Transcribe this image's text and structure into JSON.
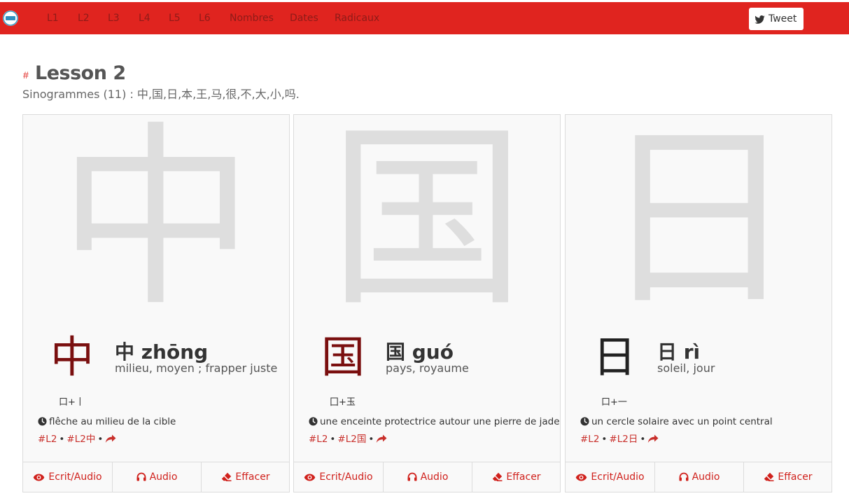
{
  "nav": {
    "items": [
      "L1",
      "L2",
      "L3",
      "L4",
      "L5",
      "L6",
      "Nombres",
      "Dates",
      "Radicaux"
    ],
    "tweet_label": "Tweet"
  },
  "lesson": {
    "hash": "#",
    "title": "Lesson 2",
    "subtitle": "Sinogrammes (11) : 中,国,日,本,王,马,很,不,大,小,吗."
  },
  "cards": [
    {
      "character": "中",
      "headword": "中 zhōng",
      "meaning": "milieu, moyen ; frapper juste",
      "decomposition": "口+丨",
      "mnemonic": "flêche au milieu de la cible",
      "tags": [
        "#L2",
        "#L2中"
      ],
      "actions": [
        "Ecrit/Audio",
        "Audio",
        "Effacer"
      ]
    },
    {
      "character": "国",
      "headword": "国 guó",
      "meaning": "pays, royaume",
      "decomposition": "囗+玉",
      "mnemonic": "une enceinte protectrice autour une pierre de jade",
      "tags": [
        "#L2",
        "#L2国"
      ],
      "actions": [
        "Ecrit/Audio",
        "Audio",
        "Effacer"
      ]
    },
    {
      "character": "日",
      "headword": "日 rì",
      "meaning": "soleil, jour",
      "decomposition": "口+一",
      "mnemonic": "un cercle solaire avec un point central",
      "tags": [
        "#L2",
        "#L2日"
      ],
      "actions": [
        "Ecrit/Audio",
        "Audio",
        "Effacer"
      ]
    }
  ],
  "colors": {
    "brand_red": "#e0241f",
    "link_red": "#c9302c",
    "stroke_red": "#7a0f0f",
    "ghost_gray": "#dedede"
  },
  "icons": {
    "logo": "site-logo-icon",
    "tweet": "twitter-bird-icon",
    "mnemonic": "clock-icon",
    "share": "share-arrow-icon",
    "write": "eye-icon",
    "audio": "headphones-icon",
    "erase": "eraser-icon"
  }
}
